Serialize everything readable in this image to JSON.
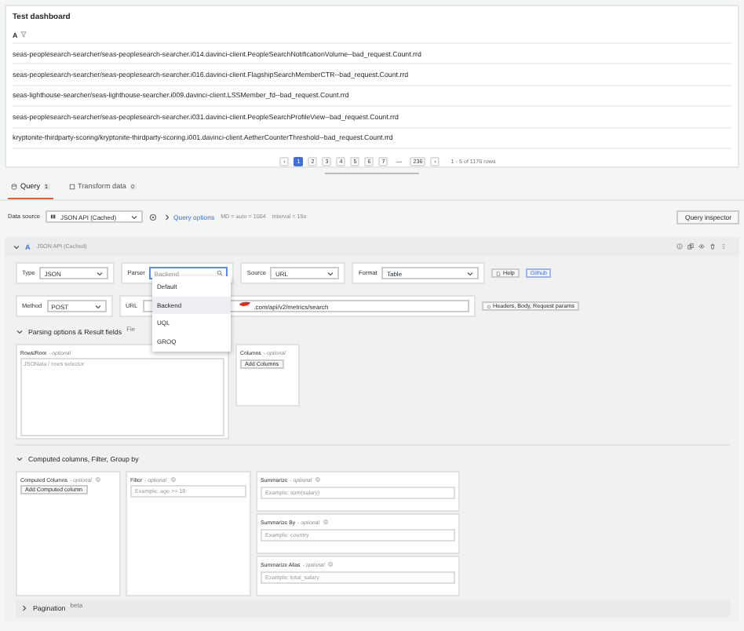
{
  "panel": {
    "title": "Test dashboard",
    "column": "A",
    "rows": [
      "seas-peoplesearch-searcher/seas-peoplesearch-searcher.i014.davinci-client.PeopleSearchNotificationVolume--bad_request.Count.rrd",
      "seas-peoplesearch-searcher/seas-peoplesearch-searcher.i016.davinci-client.FlagshipSearchMemberCTR--bad_request.Count.rrd",
      "seas-lighthouse-searcher/seas-lighthouse-searcher.i009.davinci-client.LSSMember_fd--bad_request.Count.rrd",
      "seas-peoplesearch-searcher/seas-peoplesearch-searcher.i031.davinci-client.PeopleSearchProfileView--bad_request.Count.rrd",
      "kryptonite-thirdparty-scoring/kryptonite-thirdparty-scoring.i001.davinci-client.AetherCounterThreshold--bad_request.Count.rrd"
    ],
    "pagination": {
      "prev": "‹",
      "next": "›",
      "summary": "1 - 5 of 1176 rows",
      "pages": [
        {
          "label": "1",
          "selected": true
        },
        {
          "label": "2",
          "selected": false
        },
        {
          "label": "3",
          "selected": false
        },
        {
          "label": "4",
          "selected": false
        },
        {
          "label": "5",
          "selected": false
        },
        {
          "label": "6",
          "selected": false
        },
        {
          "label": "7",
          "selected": false
        },
        {
          "label": "—",
          "kind": "gap"
        },
        {
          "label": "236",
          "selected": false
        }
      ]
    }
  },
  "tabs": [
    {
      "label": "Query",
      "count": "1",
      "selected": true
    },
    {
      "label": "Transform data",
      "count": "0",
      "selected": false
    }
  ],
  "toolbar": {
    "data_source_label": "Data source",
    "data_source": "JSON API (Cached)",
    "query_options": "Query options",
    "options_summary": "MD = auto = 1004",
    "interval": "Interval = 15s",
    "inspector": "Query inspector"
  },
  "query": {
    "ref": "A",
    "datasource": "JSON API (Cached)",
    "expanded": true,
    "fields": [
      {
        "kind": "select",
        "label": "Type",
        "value": "JSON"
      },
      {
        "kind": "search",
        "label": "Parser",
        "placeholder": "Backend"
      },
      {
        "kind": "select",
        "label": "Source",
        "value": "URL"
      },
      {
        "kind": "select",
        "label": "Format",
        "value": "Table"
      }
    ],
    "help": "Help",
    "github": "Github",
    "method": {
      "label": "Method",
      "value": "POST"
    },
    "url": {
      "label": "URL",
      "value": ".com/api/v2/metrics/search"
    },
    "params_button": "Headers, Body, Request params",
    "parser_menu": [
      {
        "label": "Default",
        "selected": false
      },
      {
        "label": "Backend",
        "selected": true
      },
      {
        "label": "UQL",
        "selected": false
      },
      {
        "label": "GROQ",
        "selected": false
      }
    ],
    "parsing": {
      "title": "Parsing options & Result fields",
      "extra": "Fie",
      "expanded": true,
      "rows_root": {
        "label": "Rows/Root",
        "hint": "- optional",
        "placeholder": "JSONata / rows selector"
      },
      "columns": {
        "label": "Columns",
        "hint": "- optional",
        "button": "Add Columns"
      }
    },
    "computed": {
      "title": "Computed columns, Filter, Group by",
      "expanded": true,
      "computed_columns": {
        "label": "Computed Columns",
        "hint": "- optional",
        "button": "Add Computed column"
      },
      "filter": {
        "label": "Filter",
        "hint": "- optional",
        "placeholder": "Example: age >= 18"
      },
      "summarize": [
        {
          "label": "Summarize",
          "hint": "- optional",
          "placeholder": "Example: sum(salary)"
        },
        {
          "label": "Summarize By",
          "hint": "- optional",
          "placeholder": "Example: country"
        },
        {
          "label": "Summarize Alias",
          "hint": "- optional",
          "placeholder": "Example: total_salary"
        }
      ]
    },
    "pagination": {
      "title": "Pagination",
      "badge": "beta",
      "expanded": false
    }
  }
}
